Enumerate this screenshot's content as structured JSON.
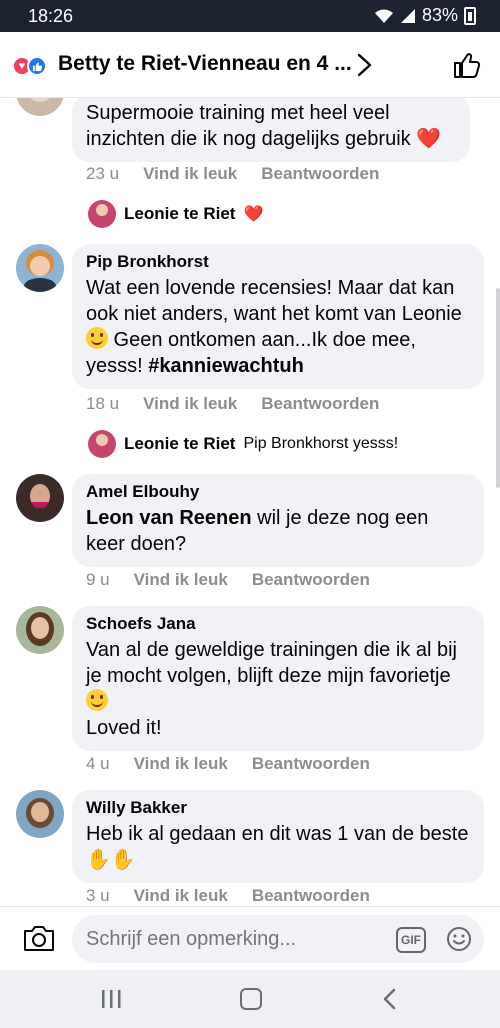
{
  "status_bar": {
    "time": "18:26",
    "battery": "83%"
  },
  "header": {
    "title": "Betty te Riet-Vienneau en 4 ..."
  },
  "comments": [
    {
      "text": "Supermooie training met heel veel inzichten die ik nog dagelijks gebruik ❤️",
      "time": "23 u",
      "like_label": "Vind ik leuk",
      "reply_label": "Beantwoorden",
      "reply": {
        "name": "Leonie te Riet",
        "text": "❤️"
      }
    },
    {
      "author": "Pip Bronkhorst",
      "text_before": "Wat een lovende recensies! Maar dat kan ook niet anders, want het komt van Leonie ",
      "text_after": " Geen ontkomen aan...Ik doe mee, yesss! ",
      "hashtag": "#kanniewachtuh",
      "time": "18 u",
      "like_label": "Vind ik leuk",
      "reply_label": "Beantwoorden",
      "reply": {
        "name": "Leonie te Riet",
        "text": "Pip Bronkhorst yesss!"
      }
    },
    {
      "author": "Amel Elbouhy",
      "mention": "Leon van Reenen",
      "text": " wil je deze nog een keer doen?",
      "time": "9 u",
      "like_label": "Vind ik leuk",
      "reply_label": "Beantwoorden"
    },
    {
      "author": "Schoefs Jana",
      "text_before": "Van al de geweldige trainingen die ik al bij je mocht volgen, blijft deze mijn favorietje ",
      "text_after": "Loved it!",
      "time": "4 u",
      "like_label": "Vind ik leuk",
      "reply_label": "Beantwoorden"
    },
    {
      "author": "Willy Bakker",
      "text": "Heb ik al gedaan en dit was 1 van de beste ",
      "time": "3 u",
      "like_label": "Vind ik leuk",
      "reply_label": "Beantwoorden"
    }
  ],
  "composer": {
    "placeholder": "Schrijf een opmerking...",
    "gif_label": "GIF"
  },
  "colors": {
    "bubble": "#f0f2f5",
    "meta_gray": "#8a8d91",
    "heart": "#f33e58",
    "like_blue": "#1877f2"
  },
  "icons": [
    "heart-reaction-icon",
    "like-reaction-icon",
    "chevron-right-icon",
    "thumbs-up-icon",
    "camera-icon",
    "gif-icon",
    "emoji-icon",
    "recent-apps-icon",
    "home-icon",
    "back-icon"
  ]
}
